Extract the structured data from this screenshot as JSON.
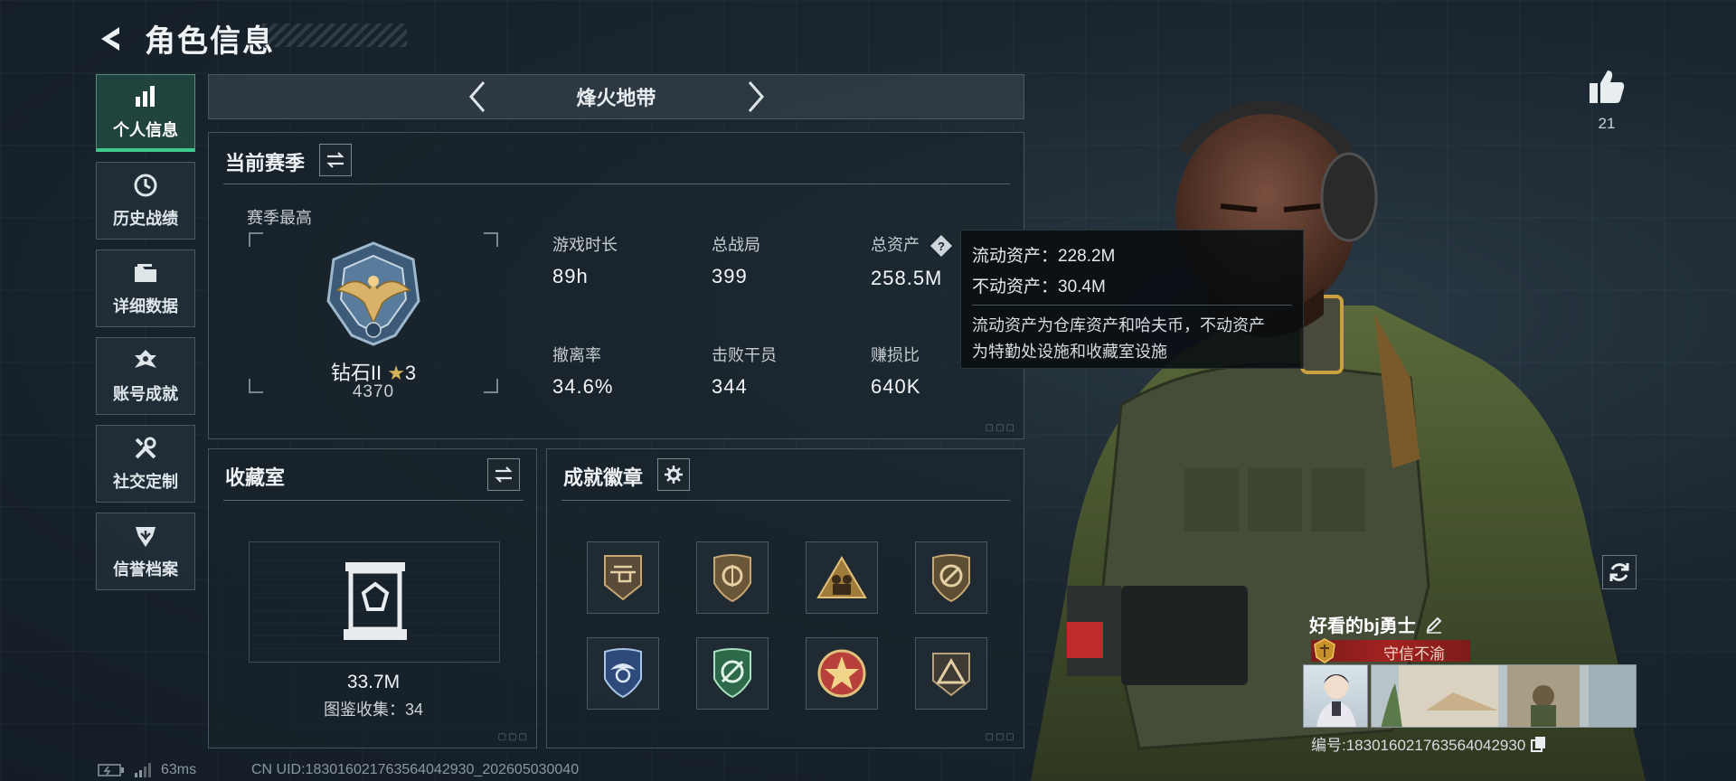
{
  "header": {
    "title": "角色信息"
  },
  "nav": {
    "items": [
      {
        "label": "个人信息",
        "icon": "bar-chart-icon",
        "active": true
      },
      {
        "label": "历史战绩",
        "icon": "history-clock-icon",
        "active": false
      },
      {
        "label": "详细数据",
        "icon": "folder-icon",
        "active": false
      },
      {
        "label": "账号成就",
        "icon": "achievement-icon",
        "active": false
      },
      {
        "label": "社交定制",
        "icon": "tools-icon",
        "active": false
      },
      {
        "label": "信誉档案",
        "icon": "shield-icon",
        "active": false
      }
    ]
  },
  "mode": {
    "name": "烽火地带"
  },
  "season": {
    "title": "当前赛季",
    "best_label": "赛季最高",
    "rank_name": "钻石II",
    "rank_stars": "3",
    "rank_score": "4370",
    "stats": [
      {
        "label": "游戏时长",
        "value": "89h"
      },
      {
        "label": "总战局",
        "value": "399"
      },
      {
        "label": "总资产",
        "value": "258.5M"
      },
      {
        "label": "撤离率",
        "value": "34.6%"
      },
      {
        "label": "击败干员",
        "value": "344"
      },
      {
        "label": "赚损比",
        "value": "640K"
      }
    ]
  },
  "tooltip": {
    "liquid": "流动资产：228.2M",
    "fixed": "不动资产：30.4M",
    "desc_line1": "流动资产为仓库资产和哈夫币，不动资产",
    "desc_line2": "为特勤处设施和收藏室设施"
  },
  "collection": {
    "title": "收藏室",
    "value": "33.7M",
    "count_text": "图鉴收集：34"
  },
  "badges": {
    "title": "成就徽章",
    "items": [
      "helicopter-badge",
      "shield-target-badge",
      "mountain-soldiers-badge",
      "no-weapon-badge",
      "blue-wing-badge",
      "green-target-badge",
      "star-medal-badge",
      "triangle-badge"
    ]
  },
  "profile": {
    "likes": "21",
    "player_name": "好看的bj勇士",
    "title": "守信不渝",
    "player_id": "编号:183016021763564042930"
  },
  "status": {
    "ping": "63ms",
    "uid": "CN UID:183016021763564042930_202605030040"
  },
  "colors": {
    "accent_green": "#3ec98f",
    "title_red": "#a32220",
    "panel_border": "#46535c"
  }
}
